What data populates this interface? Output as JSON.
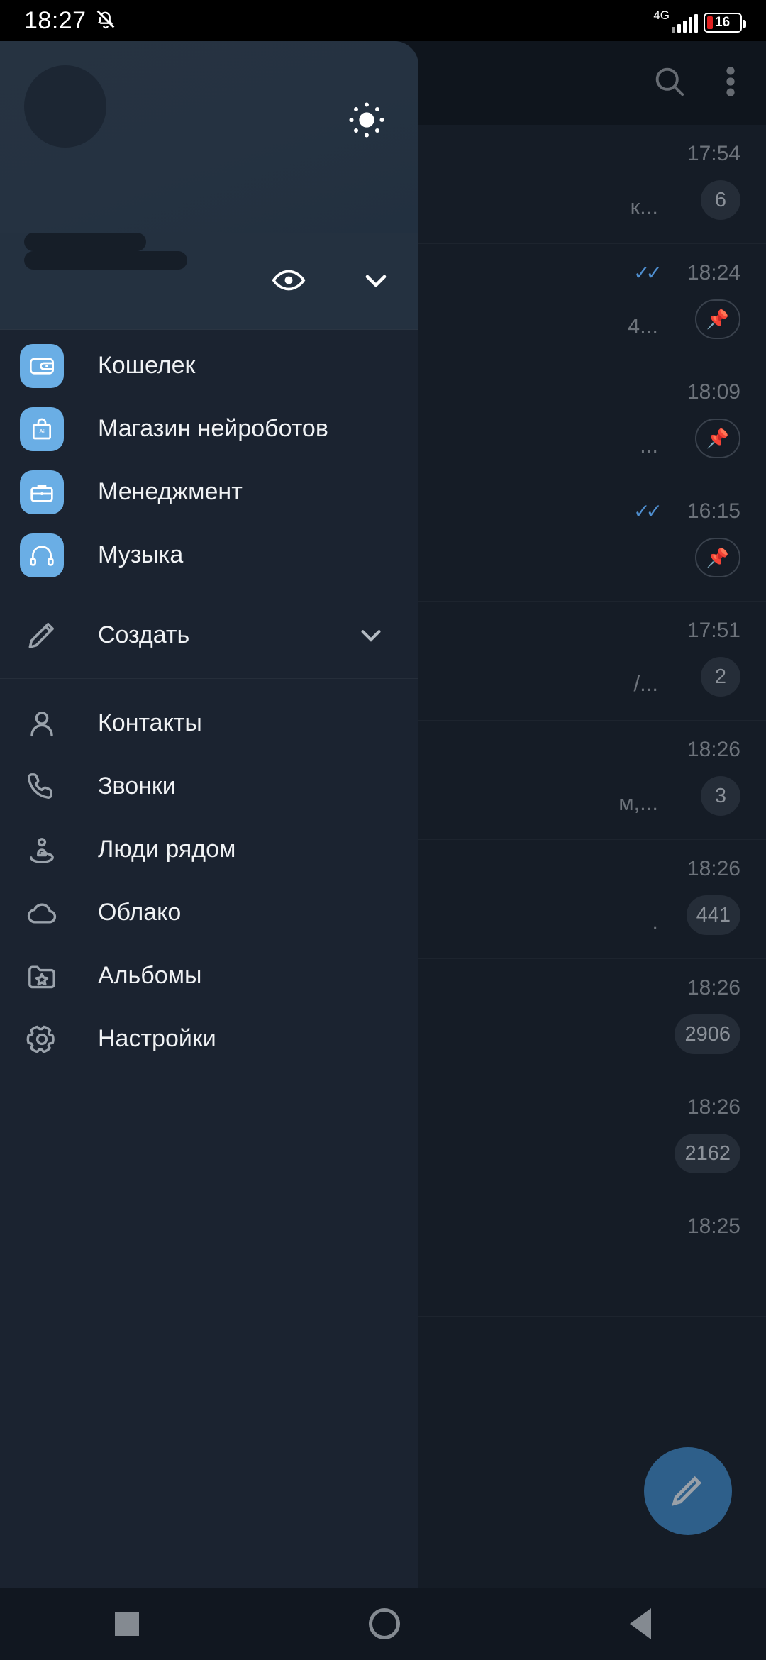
{
  "status_bar": {
    "time": "18:27",
    "mute_icon": "bell-muted-icon",
    "network_type": "4G",
    "battery_percent": "16"
  },
  "chat_list": {
    "top_bar": {
      "search_icon": "search-icon",
      "more_icon": "more-vertical-icon"
    },
    "rows": [
      {
        "time": "17:54",
        "snippet": "к...",
        "badge": "6",
        "badge_type": "count",
        "ticks": ""
      },
      {
        "time": "18:24",
        "snippet": "4...",
        "badge": "pin",
        "badge_type": "pin",
        "ticks": "✓✓"
      },
      {
        "time": "18:09",
        "snippet": "...",
        "badge": "pin",
        "badge_type": "pin",
        "ticks": ""
      },
      {
        "time": "16:15",
        "snippet": "",
        "badge": "pin",
        "badge_type": "pin",
        "ticks": "✓✓"
      },
      {
        "time": "17:51",
        "snippet": "/...",
        "badge": "2",
        "badge_type": "count",
        "ticks": ""
      },
      {
        "time": "18:26",
        "snippet": "м,...",
        "badge": "3",
        "badge_type": "count",
        "ticks": ""
      },
      {
        "time": "18:26",
        "snippet": ".",
        "badge": "441",
        "badge_type": "count",
        "ticks": ""
      },
      {
        "time": "18:26",
        "snippet": "",
        "badge": "2906",
        "badge_type": "count",
        "ticks": ""
      },
      {
        "time": "18:26",
        "snippet": "",
        "badge": "2162",
        "badge_type": "count",
        "ticks": ""
      },
      {
        "time": "18:25",
        "snippet": "",
        "badge": "",
        "badge_type": "none",
        "ticks": ""
      }
    ],
    "compose_fab_icon": "pencil-icon"
  },
  "drawer": {
    "header": {
      "avatar": "avatar-placeholder",
      "theme_toggle_icon": "sun-icon",
      "name_placeholder": "",
      "phone_placeholder": "",
      "eye_icon": "eye-icon",
      "expand_icon": "chevron-down-icon"
    },
    "app_items": [
      {
        "label": "Кошелек",
        "icon": "wallet-icon"
      },
      {
        "label": "Магазин нейроботов",
        "icon": "ai-shopping-bag-icon"
      },
      {
        "label": "Менеджмент",
        "icon": "briefcase-icon"
      },
      {
        "label": "Музыка",
        "icon": "headphones-icon"
      }
    ],
    "create_item": {
      "label": "Создать",
      "icon": "pencil-outline-icon",
      "chevron": "chevron-down-icon"
    },
    "nav_items": [
      {
        "label": "Контакты",
        "icon": "person-icon"
      },
      {
        "label": "Звонки",
        "icon": "phone-icon"
      },
      {
        "label": "Люди рядом",
        "icon": "people-nearby-icon"
      },
      {
        "label": "Облако",
        "icon": "cloud-icon"
      },
      {
        "label": "Альбомы",
        "icon": "folder-star-icon"
      },
      {
        "label": "Настройки",
        "icon": "gear-icon"
      }
    ]
  },
  "nav_bar": {
    "recents_icon": "square-icon",
    "home_icon": "circle-icon",
    "back_icon": "triangle-back-icon"
  },
  "colors": {
    "accent_blue": "#6AAEE5",
    "drawer_bg": "#1B2330",
    "drawer_header_bg": "#243140",
    "chat_bg": "#151C26",
    "tick_blue": "#4F8FD0",
    "battery_red": "#E02020"
  }
}
